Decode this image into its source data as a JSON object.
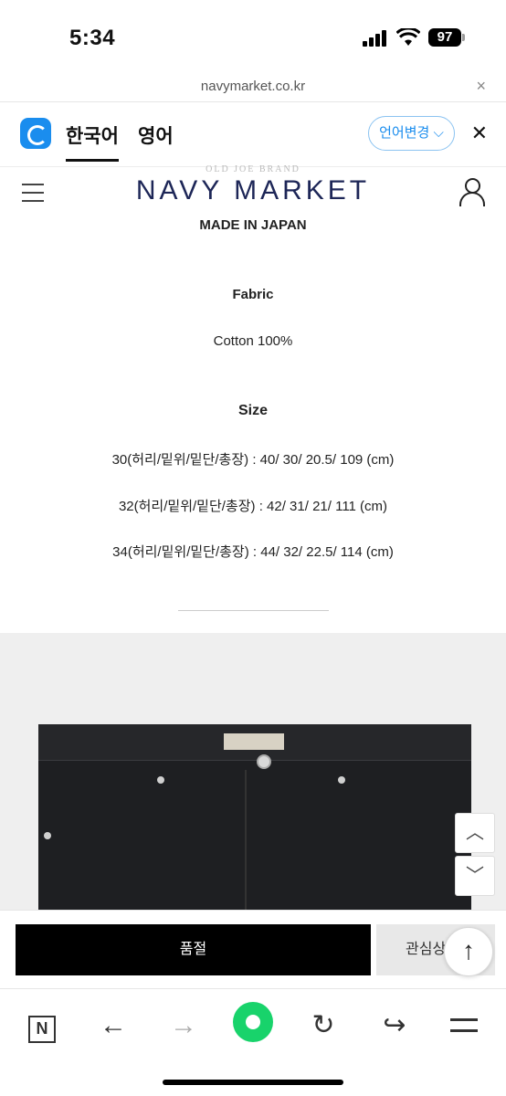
{
  "status_bar": {
    "time": "5:34",
    "battery": "97"
  },
  "url_bar": {
    "url": "navymarket.co.kr",
    "close": "×"
  },
  "translate_bar": {
    "tab_active": "한국어",
    "tab_other": "영어",
    "change_label": "언어변경 ⌵",
    "close": "✕",
    "accent_color": "#1a8dee"
  },
  "header": {
    "brand_small": "OLD JOE BRAND",
    "brand": "NAVY MARKET"
  },
  "content": {
    "made_in": "MADE IN JAPAN",
    "fabric_heading": "Fabric",
    "fabric_value": "Cotton 100%",
    "size_heading": "Size",
    "sizes": [
      "30(허리/밑위/밑단/총장) : 40/ 30/ 20.5/ 109 (cm)",
      "32(허리/밑위/밑단/총장) : 42/ 31/ 21/ 111 (cm)",
      "34(허리/밑위/밑단/총장) : 44/ 32/ 22.5/ 114 (cm)"
    ]
  },
  "scroll": {
    "up": "︿",
    "down": "﹀"
  },
  "actions": {
    "sold_out": "품절",
    "wishlist": "관심상품",
    "top": "↑"
  },
  "toolbar": {
    "n_label": "N",
    "back": "←",
    "forward": "→",
    "reload": "↻",
    "share": "↪"
  }
}
